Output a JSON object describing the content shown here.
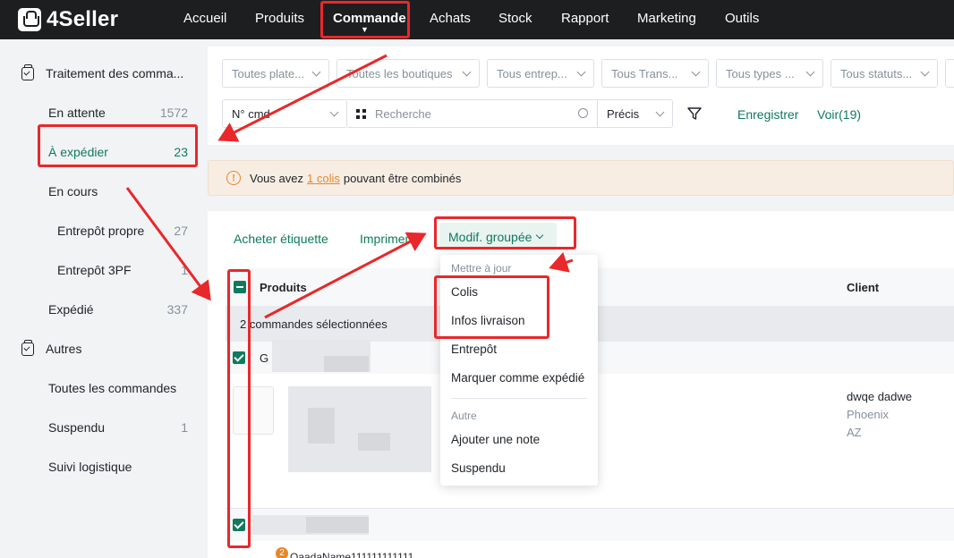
{
  "app": {
    "logo_text": "4Seller"
  },
  "nav": {
    "items": [
      "Accueil",
      "Produits",
      "Commande",
      "Achats",
      "Stock",
      "Rapport",
      "Marketing",
      "Outils"
    ],
    "active": "Commande"
  },
  "sidebar": {
    "group1": "Traitement des comma...",
    "items": [
      {
        "label": "En attente",
        "count": "1572"
      },
      {
        "label": "À expédier",
        "count": "23"
      },
      {
        "label": "En cours",
        "count": ""
      },
      {
        "label": "Entrepôt propre",
        "count": "27"
      },
      {
        "label": "Entrepôt 3PF",
        "count": "1"
      },
      {
        "label": "Expédié",
        "count": "337"
      }
    ],
    "group2": "Autres",
    "items2": [
      {
        "label": "Toutes les commandes",
        "count": ""
      },
      {
        "label": "Suspendu",
        "count": "1"
      },
      {
        "label": "Suivi logistique",
        "count": ""
      }
    ]
  },
  "filters": {
    "selects": [
      "Toutes plate...",
      "Toutes les boutiques",
      "Tous entrep...",
      "Tous Trans...",
      "Tous types ...",
      "Tous statuts..."
    ],
    "order_field": "N° cmd",
    "search_placeholder": "Recherche",
    "match_mode": "Précis",
    "save_label": "Enregistrer",
    "view_label": "Voir(19)"
  },
  "notice": {
    "before": "Vous avez",
    "link": "1 colis",
    "after": "pouvant être combinés"
  },
  "actions": {
    "buy_label": "Acheter étiquette",
    "print_label": "Imprimer",
    "bulk_edit_label": "Modif. groupée"
  },
  "table": {
    "col_products": "Produits",
    "col_client": "Client",
    "selected_text": "2 commandes sélectionnées",
    "row1_prefix": "G",
    "client": {
      "name": "dwqe dadwe",
      "city": "Phoenix",
      "state": "AZ"
    },
    "badge": "2",
    "partial_sku": "QaadaName111111111111"
  },
  "dropdown": {
    "section1": "Mettre à jour",
    "items1": [
      "Colis",
      "Infos livraison",
      "Entrepôt",
      "Marquer comme expédié"
    ],
    "section2": "Autre",
    "items2": [
      "Ajouter une note",
      "Suspendu"
    ]
  },
  "colors": {
    "accent": "#0f7a5e",
    "warning": "#e8872a",
    "annotation": "#e8282b",
    "topbar": "#1d1e20"
  }
}
